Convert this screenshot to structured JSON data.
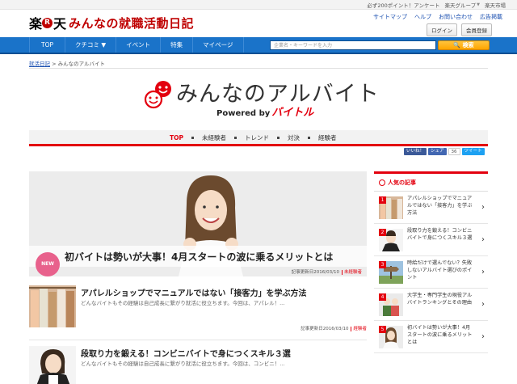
{
  "util": {
    "point": "必ず200ポイント！アンケート",
    "group": "楽天グループ",
    "market": "楽天市場"
  },
  "brand": {
    "raku": "楽",
    "r": "R",
    "ten": "天",
    "name": "みんなの就職活動日記"
  },
  "header": {
    "links": [
      "サイトマップ",
      "ヘルプ",
      "お問い合わせ",
      "広告掲載"
    ],
    "login": "ログイン",
    "register": "会員登録"
  },
  "nav": {
    "items": [
      "TOP",
      "クチコミ ▼",
      "イベント",
      "特集",
      "マイページ"
    ],
    "search_placeholder": "企業名・キーワードを入力",
    "search_button": "🔍 検索"
  },
  "breadcrumb": {
    "home": "就活日記",
    "sep": " > ",
    "current": "みんなのアルバイト"
  },
  "logo": {
    "title": "みんなのアルバイト",
    "powered": "Powered by",
    "bite": "バイトル"
  },
  "subnav": {
    "items": [
      "TOP",
      "未経験者",
      "トレンド",
      "対決",
      "経験者"
    ]
  },
  "social": {
    "like": "いいね！",
    "share": "シェア",
    "count": "36",
    "tweet": "ツイート"
  },
  "hero": {
    "badge": "NEW",
    "title": "初バイトは勢いが大事！4月スタートの波に乗るメリットとは",
    "date": "記事更新日2016/03/10",
    "tag": "未経験者"
  },
  "articles": [
    {
      "title": "アパレルショップでマニュアルではない「接客力」を学ぶ方法",
      "desc": "どんなバイトもその経験は自己成長に繋がり就活に役立ちます。今回は、アパレル！...",
      "date": "記事更新日2016/03/10",
      "tag": "経験者"
    },
    {
      "title": "段取り力を鍛える！コンビニバイトで身につくスキル３選",
      "desc": "どんなバイトもその経験は自己成長に繋がり就活に役立ちます。今回は、コンビニ！...",
      "date": "",
      "tag": ""
    }
  ],
  "sidebar": {
    "heading": "人気の記事",
    "items": [
      {
        "rank": "1",
        "text": "アパレルショップでマニュアルではない「接客力」を学ぶ方法"
      },
      {
        "rank": "2",
        "text": "段取り力を鍛える！コンビニバイトで身につくスキル３選"
      },
      {
        "rank": "3",
        "text": "時給だけで選んでない？失敗しないアルバイト選びのポイント"
      },
      {
        "rank": "4",
        "text": "大学生・専門学生の現役アルバイトランキングとその理由"
      },
      {
        "rank": "5",
        "text": "初バイトは勢いが大事！4月スタートの波に乗るメリットとは"
      }
    ]
  },
  "colors": {
    "brand_red": "#bf0000",
    "nav_blue": "#1a73c9",
    "accent_red": "#e3000f",
    "new_pink": "#e8618c"
  }
}
